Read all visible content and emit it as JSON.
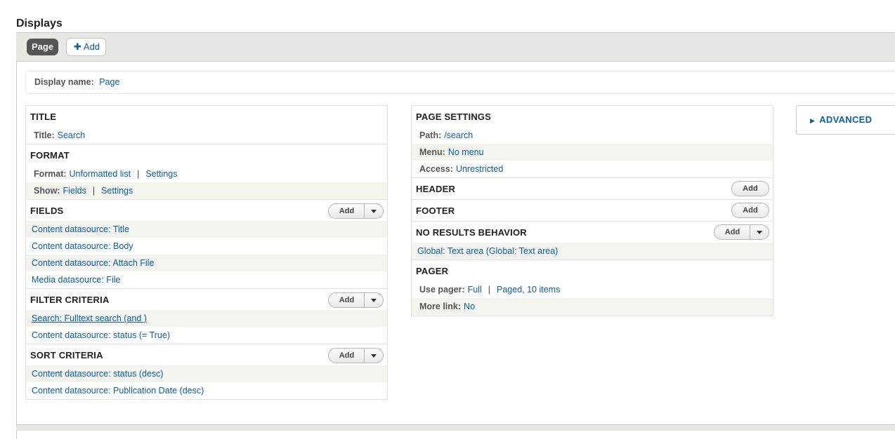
{
  "page": {
    "heading": "Displays"
  },
  "tabs": {
    "active": "Page",
    "add_label": "Add",
    "add_icon": "plus-icon"
  },
  "display_name": {
    "label": "Display name:",
    "value": "Page"
  },
  "buttons": {
    "add": "Add"
  },
  "left": {
    "title": {
      "heading": "TITLE",
      "label": "Title:",
      "value": "Search"
    },
    "format": {
      "heading": "FORMAT",
      "format_label": "Format:",
      "format_value": "Unformatted list",
      "format_settings": "Settings",
      "show_label": "Show:",
      "show_value": "Fields",
      "show_settings": "Settings",
      "separator": "|"
    },
    "fields": {
      "heading": "FIELDS",
      "items": [
        "Content datasource: Title",
        "Content datasource: Body",
        "Content datasource: Attach File",
        "Media datasource: File"
      ]
    },
    "filter": {
      "heading": "FILTER CRITERIA",
      "items": [
        "Search: Fulltext search (and )",
        "Content datasource: status (= True)"
      ]
    },
    "sort": {
      "heading": "SORT CRITERIA",
      "items": [
        "Content datasource: status (desc)",
        "Content datasource: Publication Date (desc)"
      ]
    }
  },
  "right": {
    "page_settings": {
      "heading": "PAGE SETTINGS",
      "path_label": "Path:",
      "path_value": "/search",
      "menu_label": "Menu:",
      "menu_value": "No menu",
      "access_label": "Access:",
      "access_value": "Unrestricted"
    },
    "header": {
      "heading": "HEADER"
    },
    "footer": {
      "heading": "FOOTER"
    },
    "no_results": {
      "heading": "NO RESULTS BEHAVIOR",
      "items": [
        "Global: Text area (Global: Text area)"
      ]
    },
    "pager": {
      "heading": "PAGER",
      "use_label": "Use pager:",
      "use_value": "Full",
      "use_detail": "Paged, 10 items",
      "more_label": "More link:",
      "more_value": "No",
      "separator": "|"
    }
  },
  "advanced": {
    "label": "ADVANCED",
    "icon": "triangle-right-icon"
  },
  "colors": {
    "link": "#0a60a8",
    "active_tab": "#555555",
    "bar": "#e7e7e4",
    "alt_row": "#f3f4ee"
  }
}
